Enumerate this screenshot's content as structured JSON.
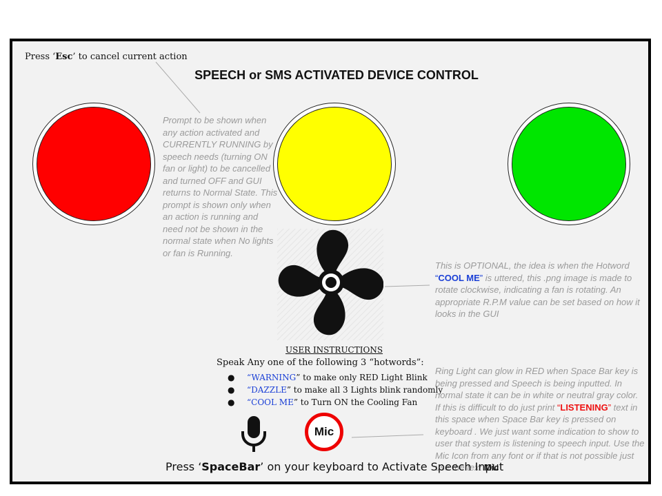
{
  "header": {
    "esc_prefix": "Press ‘",
    "esc_key": "Esc",
    "esc_suffix": "’ to cancel current action",
    "title": "SPEECH or SMS ACTIVATED DEVICE CONTROL"
  },
  "lights": [
    {
      "name": "red",
      "color": "#ff0000"
    },
    {
      "name": "yellow",
      "color": "#ffff00"
    },
    {
      "name": "green",
      "color": "#00e600"
    }
  ],
  "prompt_note": "Prompt to be shown when any action activated and CURRENTLY RUNNING by speech needs (turning ON fan or light) to be cancelled and turned OFF and GUI returns to Normal State. This prompt is shown only when an action is running and need not be shown in the normal state when No lights or fan is Running.",
  "fan_note": {
    "before": "This is OPTIONAL, the idea is when the Hotword ",
    "open_quote": "“",
    "keyword": "COOL ME",
    "close_quote": "”",
    "after": " is uttered, this .png image is made to rotate clockwise, indicating a fan is rotating. An appropriate R.P.M value can be set based on how it looks in the GUI"
  },
  "instructions": {
    "title": "USER INSTRUCTIONS",
    "lead": "Speak Any one of the following 3 “hotwords”:",
    "items": [
      {
        "bullet": "●",
        "open": "“",
        "keyword": "WARNING",
        "rest": "” to make only RED Light Blink"
      },
      {
        "bullet": "●",
        "open": "“",
        "keyword": "DAZZLE",
        "rest": "” to make all 3 Lights blink randomly"
      },
      {
        "bullet": "●",
        "open": "“",
        "keyword": "COOL ME",
        "rest": "” to Turn ON the Cooling Fan"
      }
    ]
  },
  "ring_note": {
    "part1": "Ring Light can glow in RED when Space Bar key is being pressed and Speech is being inputted. In normal state it can be in white or neutral gray color. If this is difficult to do just print ",
    "open_quote": "“",
    "listening": "LISTENING",
    "close_quote": "”",
    "part2": " text in this space when Space Bar key is pressed on keyboard . We just want some indication to show to user that system is listening to speech input. Use the Mic Icon from any font or if that is not possible just use the text ",
    "mic_word": "Mic"
  },
  "mic_button_label": "Mic",
  "footer": {
    "prefix": "Press ‘",
    "key": "SpaceBar",
    "suffix": "’ on your keyboard to Activate Speech Input"
  },
  "colors": {
    "ring": "#ee0000",
    "keyword_blue": "#1a3fd6",
    "note_gray": "#9a9a9a"
  }
}
